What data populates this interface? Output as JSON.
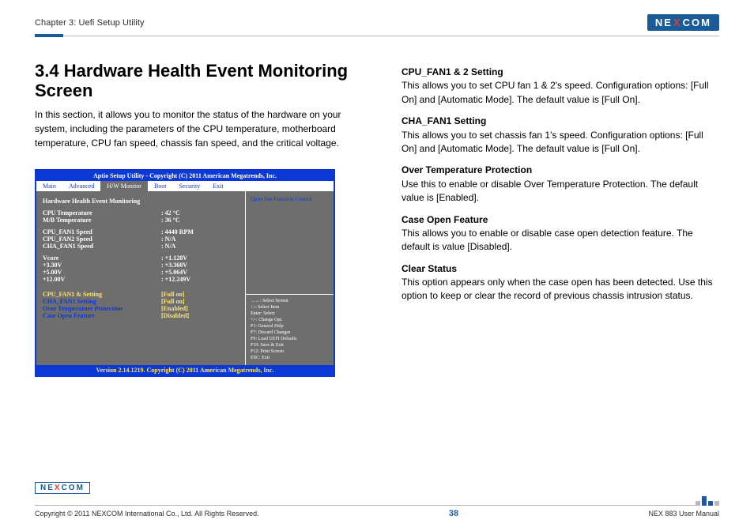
{
  "header": {
    "chapter": "Chapter 3: Uefi Setup Utility",
    "logo": {
      "left": "NE",
      "mid": "X",
      "right": "COM"
    }
  },
  "left": {
    "title": "3.4 Hardware Health Event Monitoring Screen",
    "intro": "In this section, it allows you to monitor the status of the hardware on your system, including the parameters of the CPU temperature, motherboard temperature, CPU fan speed, chassis fan speed, and the critical voltage."
  },
  "bios": {
    "title": "Aptio Setup Utility - Copyright (C) 2011 American Megatrends, Inc.",
    "menu": [
      "Main",
      "Advanced",
      "H/W Monitor",
      "Boot",
      "Security",
      "Exit"
    ],
    "menu_active_idx": 2,
    "section": "Hardware Health Event Monitoring",
    "temps": [
      {
        "k": "CPU Temperature",
        "v": ": 42 °C"
      },
      {
        "k": "M/B Temperature",
        "v": ": 36 °C"
      }
    ],
    "fans": [
      {
        "k": "CPU_FAN1 Speed",
        "v": ": 4440 RPM"
      },
      {
        "k": "CPU_FAN2 Speed",
        "v": ": N/A"
      },
      {
        "k": "CHA_FAN1 Speed",
        "v": ": N/A"
      }
    ],
    "volts": [
      {
        "k": "Vcore",
        "v": ": +1.128V"
      },
      {
        "k": "+3.30V",
        "v": ": +3.360V"
      },
      {
        "k": "+5.00V",
        "v": ": +5.064V"
      },
      {
        "k": "+12.00V",
        "v": ": +12.249V"
      }
    ],
    "opts": [
      {
        "k": "CPU_FAN1 & Setting",
        "v": "[Full on]",
        "kcolor": "#ffe36b",
        "vcolor": "#ffe36b"
      },
      {
        "k": "CHA_FAN1 Setting",
        "v": "[Full on]",
        "kcolor": "#0c39d6",
        "vcolor": "#ffe36b"
      },
      {
        "k": "Over Temperature Protection",
        "v": "[Enabled]",
        "kcolor": "#0c39d6",
        "vcolor": "#ffe36b"
      },
      {
        "k": "Case Open Feature",
        "v": "[Disabled]",
        "kcolor": "#0c39d6",
        "vcolor": "#ffe36b"
      }
    ],
    "help_title": "Quiet Fan Function Control",
    "keys": [
      "→←: Select Screen",
      "↑↓: Select Item",
      "Enter: Select",
      "+/-: Change Opt.",
      "F1: General Help",
      "F7: Discard Changes",
      "F9: Load UEFI Defaults",
      "F10: Save & Exit",
      "F12: Print Screen",
      "ESC: Exit"
    ],
    "footer": "Version 2.14.1219. Copyright (C) 2011 American Megatrends, Inc."
  },
  "right": {
    "items": [
      {
        "h": "CPU_FAN1 & 2 Setting",
        "p": "This allows you to set CPU fan 1 & 2's speed. Configuration options: [Full On] and [Automatic Mode]. The default value is [Full On]."
      },
      {
        "h": "CHA_FAN1 Setting",
        "p": "This allows you to set chassis fan 1's speed. Configuration options: [Full On] and [Automatic Mode]. The default value is [Full On]."
      },
      {
        "h": "Over Temperature Protection",
        "p": "Use this to enable or disable Over Temperature Protection. The default value is [Enabled]."
      },
      {
        "h": "Case Open Feature",
        "p": "This allows you to enable or disable case open detection feature. The default is value [Disabled]."
      },
      {
        "h": "Clear Status",
        "p": "This option appears only when the case open has been detected. Use this option to keep or clear the record of previous chassis intrusion status."
      }
    ]
  },
  "footer": {
    "copyright": "Copyright © 2011 NEXCOM International Co., Ltd. All Rights Reserved.",
    "page": "38",
    "manual": "NEX 883 User Manual",
    "logo": {
      "left": "NE",
      "mid": "X",
      "right": "COM"
    }
  }
}
